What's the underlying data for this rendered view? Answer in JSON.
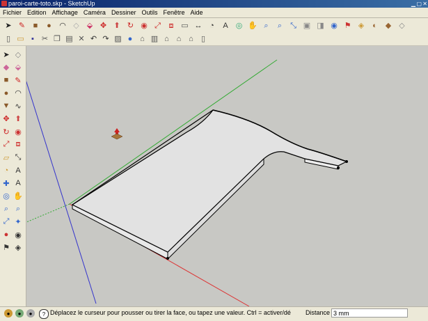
{
  "window": {
    "title": "paroi-carte-toto.skp - SketchUp"
  },
  "menu": [
    "Fichier",
    "Edition",
    "Affichage",
    "Caméra",
    "Dessiner",
    "Outils",
    "Fenêtre",
    "Aide"
  ],
  "toolbar1": [
    {
      "icon": "select-arrow-icon",
      "glyph": "➤",
      "color": "#222"
    },
    {
      "icon": "pencil-icon",
      "glyph": "✎",
      "color": "#c22"
    },
    {
      "icon": "rectangle-icon",
      "glyph": "■",
      "color": "#8a5a2a"
    },
    {
      "icon": "circle-icon",
      "glyph": "●",
      "color": "#8a5a2a"
    },
    {
      "icon": "arc-icon",
      "glyph": "◠",
      "color": "#333"
    },
    {
      "icon": "eraser-icon",
      "glyph": "◇",
      "color": "#aaa"
    },
    {
      "icon": "paint-bucket-icon",
      "glyph": "⬙",
      "color": "#c36"
    },
    {
      "icon": "move-icon",
      "glyph": "✥",
      "color": "#c22"
    },
    {
      "icon": "push-pull-icon",
      "glyph": "⬆",
      "color": "#c44"
    },
    {
      "icon": "rotate-icon",
      "glyph": "↻",
      "color": "#c22"
    },
    {
      "icon": "follow-me-icon",
      "glyph": "◉",
      "color": "#c33"
    },
    {
      "icon": "scale-icon",
      "glyph": "⤢",
      "color": "#c22"
    },
    {
      "icon": "offset-icon",
      "glyph": "⧈",
      "color": "#c22"
    },
    {
      "icon": "tape-measure-icon",
      "glyph": "▭",
      "color": "#555"
    },
    {
      "icon": "dimension-icon",
      "glyph": "↔",
      "color": "#333"
    },
    {
      "icon": "protractor-icon",
      "glyph": "◔",
      "color": "#333"
    },
    {
      "icon": "text-icon",
      "glyph": "A",
      "color": "#333"
    },
    {
      "icon": "orbit-icon",
      "glyph": "◎",
      "color": "#3a7"
    },
    {
      "icon": "pan-icon",
      "glyph": "✋",
      "color": "#a75"
    },
    {
      "icon": "zoom-icon",
      "glyph": "⌕",
      "color": "#36c"
    },
    {
      "icon": "zoom-window-icon",
      "glyph": "⌕",
      "color": "#36c"
    },
    {
      "icon": "zoom-extents-icon",
      "glyph": "⤡",
      "color": "#36c"
    },
    {
      "icon": "previous-view-icon",
      "glyph": "▣",
      "color": "#888"
    },
    {
      "icon": "position-camera-icon",
      "glyph": "◨",
      "color": "#888"
    },
    {
      "icon": "look-around-icon",
      "glyph": "◉",
      "color": "#36c"
    },
    {
      "icon": "walk-icon",
      "glyph": "⚑",
      "color": "#c33"
    },
    {
      "icon": "section-plane-icon",
      "glyph": "◈",
      "color": "#c93"
    },
    {
      "icon": "components-icon",
      "glyph": "◐",
      "color": "#963"
    },
    {
      "icon": "warehouse-icon",
      "glyph": "◆",
      "color": "#963"
    },
    {
      "icon": "share-model-icon",
      "glyph": "◇",
      "color": "#888"
    }
  ],
  "toolbar2": [
    {
      "icon": "new-icon",
      "glyph": "▯",
      "color": "#555"
    },
    {
      "icon": "open-icon",
      "glyph": "▭",
      "color": "#c93"
    },
    {
      "icon": "save-icon",
      "glyph": "▪",
      "color": "#339"
    },
    {
      "icon": "cut-icon",
      "glyph": "✂",
      "color": "#555"
    },
    {
      "icon": "copy-icon",
      "glyph": "❐",
      "color": "#555"
    },
    {
      "icon": "paste-icon",
      "glyph": "▤",
      "color": "#555"
    },
    {
      "icon": "erase-icon",
      "glyph": "✕",
      "color": "#555"
    },
    {
      "icon": "undo-icon",
      "glyph": "↶",
      "color": "#333"
    },
    {
      "icon": "redo-icon",
      "glyph": "↷",
      "color": "#333"
    },
    {
      "icon": "print-icon",
      "glyph": "▨",
      "color": "#555"
    },
    {
      "icon": "model-info-icon",
      "glyph": "●",
      "color": "#36c"
    },
    {
      "icon": "iso-view-icon",
      "glyph": "⌂",
      "color": "#555"
    },
    {
      "icon": "top-view-icon",
      "glyph": "▥",
      "color": "#555"
    },
    {
      "icon": "front-view-icon",
      "glyph": "⌂",
      "color": "#555"
    },
    {
      "icon": "right-view-icon",
      "glyph": "⌂",
      "color": "#555"
    },
    {
      "icon": "back-view-icon",
      "glyph": "⌂",
      "color": "#555"
    },
    {
      "icon": "left-view-icon",
      "glyph": "▯",
      "color": "#555"
    }
  ],
  "lefttools": [
    {
      "icon": "select-icon",
      "glyph": "➤",
      "color": "#222"
    },
    {
      "icon": "make-component-icon",
      "glyph": "◇",
      "color": "#888"
    },
    {
      "icon": "eraser-icon",
      "glyph": "◆",
      "color": "#c69"
    },
    {
      "icon": "paint-icon",
      "glyph": "⬙",
      "color": "#c69"
    },
    {
      "icon": "rectangle-icon",
      "glyph": "■",
      "color": "#8a5a2a"
    },
    {
      "icon": "line-icon",
      "glyph": "✎",
      "color": "#c22"
    },
    {
      "icon": "circle-icon",
      "glyph": "●",
      "color": "#8a5a2a"
    },
    {
      "icon": "arc-icon",
      "glyph": "◠",
      "color": "#333"
    },
    {
      "icon": "polygon-icon",
      "glyph": "▼",
      "color": "#8a5a2a"
    },
    {
      "icon": "freehand-icon",
      "glyph": "∿",
      "color": "#333"
    },
    {
      "icon": "move-icon",
      "glyph": "✥",
      "color": "#c22"
    },
    {
      "icon": "push-pull-icon",
      "glyph": "⬆",
      "color": "#c44"
    },
    {
      "icon": "rotate-icon",
      "glyph": "↻",
      "color": "#c22"
    },
    {
      "icon": "follow-me-icon",
      "glyph": "◉",
      "color": "#c33"
    },
    {
      "icon": "scale-icon",
      "glyph": "⤢",
      "color": "#c22"
    },
    {
      "icon": "offset-icon",
      "glyph": "⧈",
      "color": "#c22"
    },
    {
      "icon": "tape-measure-icon",
      "glyph": "▱",
      "color": "#c93"
    },
    {
      "icon": "dimension-icon",
      "glyph": "⤡",
      "color": "#333"
    },
    {
      "icon": "protractor-icon",
      "glyph": "◔",
      "color": "#c93"
    },
    {
      "icon": "text-icon",
      "glyph": "A",
      "color": "#333"
    },
    {
      "icon": "axes-icon",
      "glyph": "✚",
      "color": "#36c"
    },
    {
      "icon": "3d-text-icon",
      "glyph": "A",
      "color": "#333"
    },
    {
      "icon": "orbit-icon",
      "glyph": "◎",
      "color": "#36c"
    },
    {
      "icon": "pan-icon",
      "glyph": "✋",
      "color": "#a75"
    },
    {
      "icon": "zoom-icon",
      "glyph": "⌕",
      "color": "#36c"
    },
    {
      "icon": "zoom-window-icon",
      "glyph": "⌕",
      "color": "#36c"
    },
    {
      "icon": "zoom-extents-icon",
      "glyph": "⤢",
      "color": "#36c"
    },
    {
      "icon": "previous-icon",
      "glyph": "✦",
      "color": "#36c"
    },
    {
      "icon": "position-camera-icon",
      "glyph": "●",
      "color": "#c33"
    },
    {
      "icon": "look-around-icon",
      "glyph": "◉",
      "color": "#333"
    },
    {
      "icon": "walk-icon",
      "glyph": "⚑",
      "color": "#333"
    },
    {
      "icon": "section-plane-icon",
      "glyph": "◈",
      "color": "#333"
    }
  ],
  "status": {
    "message": "Déplacez le curseur pour pousser ou tirer la face, ou tapez une valeur. Ctrl = activer/dé",
    "measure_label": "Distance",
    "measure_value": "3 mm"
  },
  "colors": {
    "viewport_bg": "#c8c8c4",
    "face": "#e2e2e2",
    "axis_red": "#d33",
    "axis_green": "#3a3",
    "axis_blue": "#33c"
  }
}
